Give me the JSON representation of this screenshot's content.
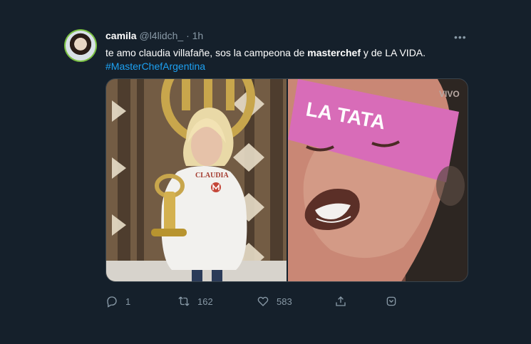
{
  "tweet": {
    "author": {
      "name": "camila",
      "handle": "@l4lidch_",
      "time": "1h"
    },
    "text": {
      "part1": "te amo claudia villafañe, sos la campeona de ",
      "bold": "masterchef",
      "part2": " y de LA VIDA.",
      "hashtag": "#MasterChefArgentina"
    },
    "media": {
      "left_label": "CLAUDIA",
      "right_headband": "LA TATA",
      "right_corner": "VIVO"
    },
    "actions": {
      "replies": "1",
      "retweets": "162",
      "likes": "583"
    }
  },
  "icons": {
    "more": "more-icon",
    "reply": "reply-icon",
    "retweet": "retweet-icon",
    "like": "heart-icon",
    "share": "share-icon",
    "bookmark": "bookmark-icon"
  },
  "colors": {
    "background": "#15202b",
    "muted": "#8899a6",
    "link": "#1da1f2",
    "avatar_ring": "#7bc144"
  }
}
